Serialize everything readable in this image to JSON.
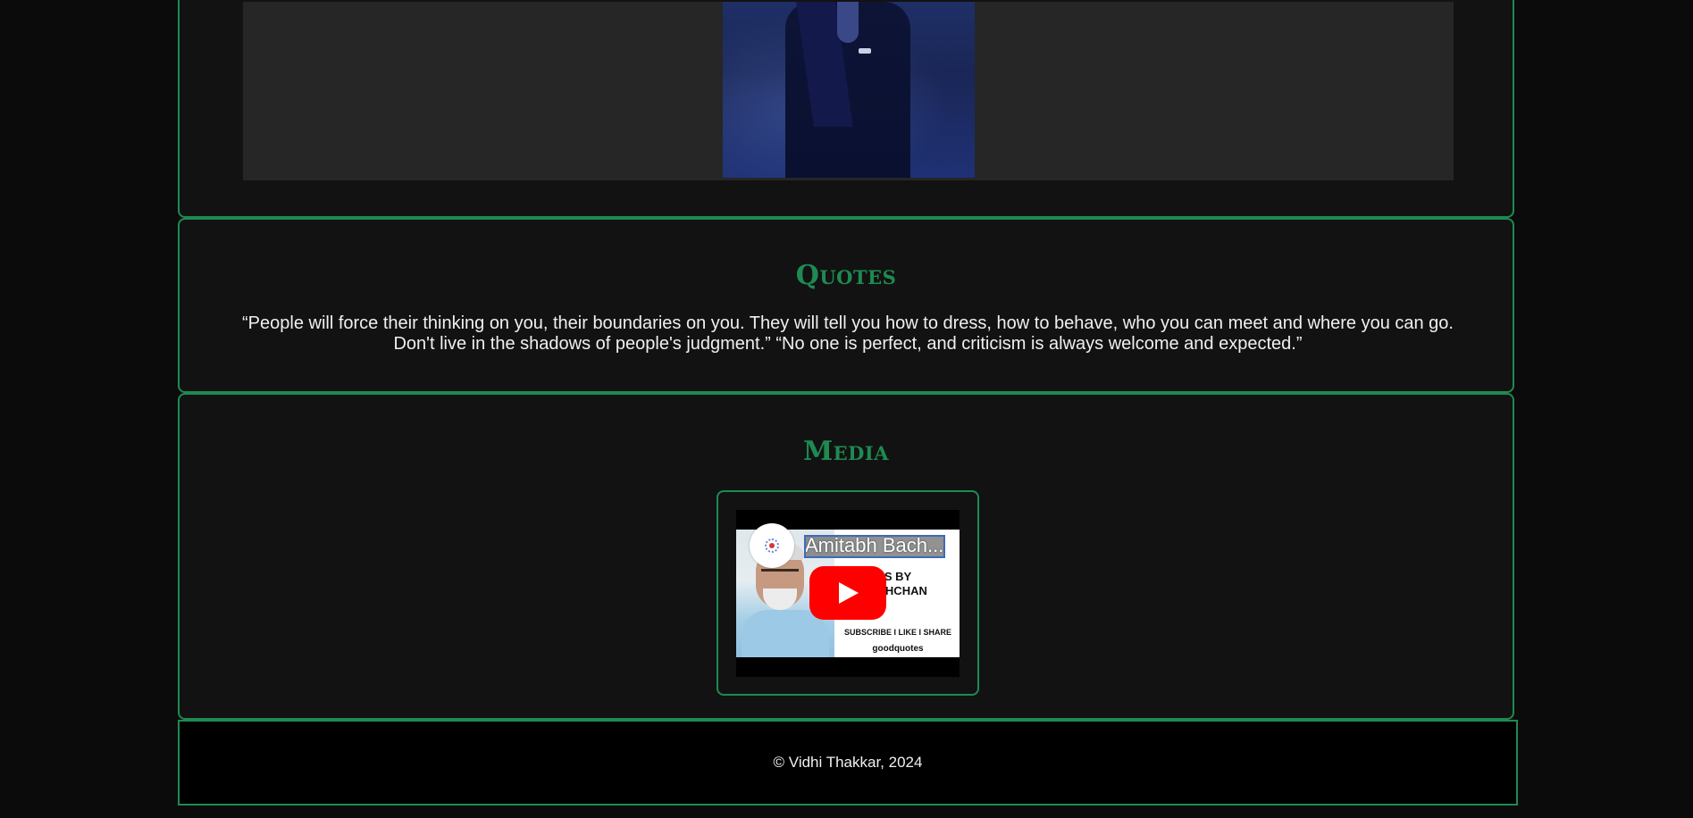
{
  "quotes": {
    "title": "Quotes",
    "text": "“People will force their thinking on you, their boundaries on you. They will tell you how to dress, how to behave, who you can meet and where you can go. Don't live in the shadows of people's judgment.” “No one is perfect, and criticism is always welcome and expected.”"
  },
  "media": {
    "title": "Media",
    "video": {
      "title": "Amitabh Bach...",
      "thumbnail_line1": "S BY",
      "thumbnail_line2": "ACHCHAN",
      "thumbnail_line3": "SUBSCRIBE I LIKE I SHARE",
      "thumbnail_line4": "goodquotes"
    }
  },
  "footer": {
    "text": "© Vidhi Thakkar, 2024"
  },
  "colors": {
    "accent": "#1e8a52",
    "background": "#0b0b0b",
    "panel": "#121212",
    "youtube_red": "#ff0000"
  },
  "icons": [
    "play-icon",
    "channel-avatar-icon"
  ]
}
